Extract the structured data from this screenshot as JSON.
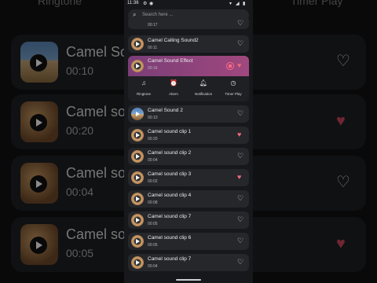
{
  "background": {
    "header_left": "Ringtone",
    "header_right": "Timer Play",
    "rows": [
      {
        "title": "Camel Sound",
        "time": "00:10",
        "favorite": false
      },
      {
        "title": "Camel sound",
        "time": "00:20",
        "favorite": true
      },
      {
        "title": "Camel sound",
        "time": "00:04",
        "favorite": false
      },
      {
        "title": "Camel sound",
        "time": "00:05",
        "favorite": true
      }
    ]
  },
  "status_bar": {
    "time": "11:36"
  },
  "search": {
    "placeholder": "Search here ..."
  },
  "list": {
    "items": [
      {
        "title": "",
        "duration": "00:17",
        "favorite": false
      },
      {
        "title": "Camel Calling Sound2",
        "duration": "00:11",
        "favorite": false
      },
      {
        "title": "Camel Sound Effect",
        "duration": "00:16",
        "favorite": true,
        "playing": true
      },
      {
        "title": "Camel Sound 2",
        "duration": "00:10",
        "favorite": false
      },
      {
        "title": "Camel sound clip 1",
        "duration": "00:20",
        "favorite": true
      },
      {
        "title": "Camel sound clip 2",
        "duration": "00:04",
        "favorite": false
      },
      {
        "title": "Camel sound clip 3",
        "duration": "00:02",
        "favorite": true
      },
      {
        "title": "Camel sound clip 4",
        "duration": "00:08",
        "favorite": false
      },
      {
        "title": "Camel sound clip 7",
        "duration": "00:05",
        "favorite": false
      },
      {
        "title": "Camel sound clip 6",
        "duration": "00:05",
        "favorite": false
      },
      {
        "title": "Camel sound clip 7",
        "duration": "00:04",
        "favorite": false
      }
    ]
  },
  "actions": {
    "ringtone": "Ringtone",
    "alarm": "Alarm",
    "notification": "Notification",
    "timer_play": "Timer Play"
  },
  "colors": {
    "accent": "#a0487e",
    "favorite": "#f06a7e"
  }
}
